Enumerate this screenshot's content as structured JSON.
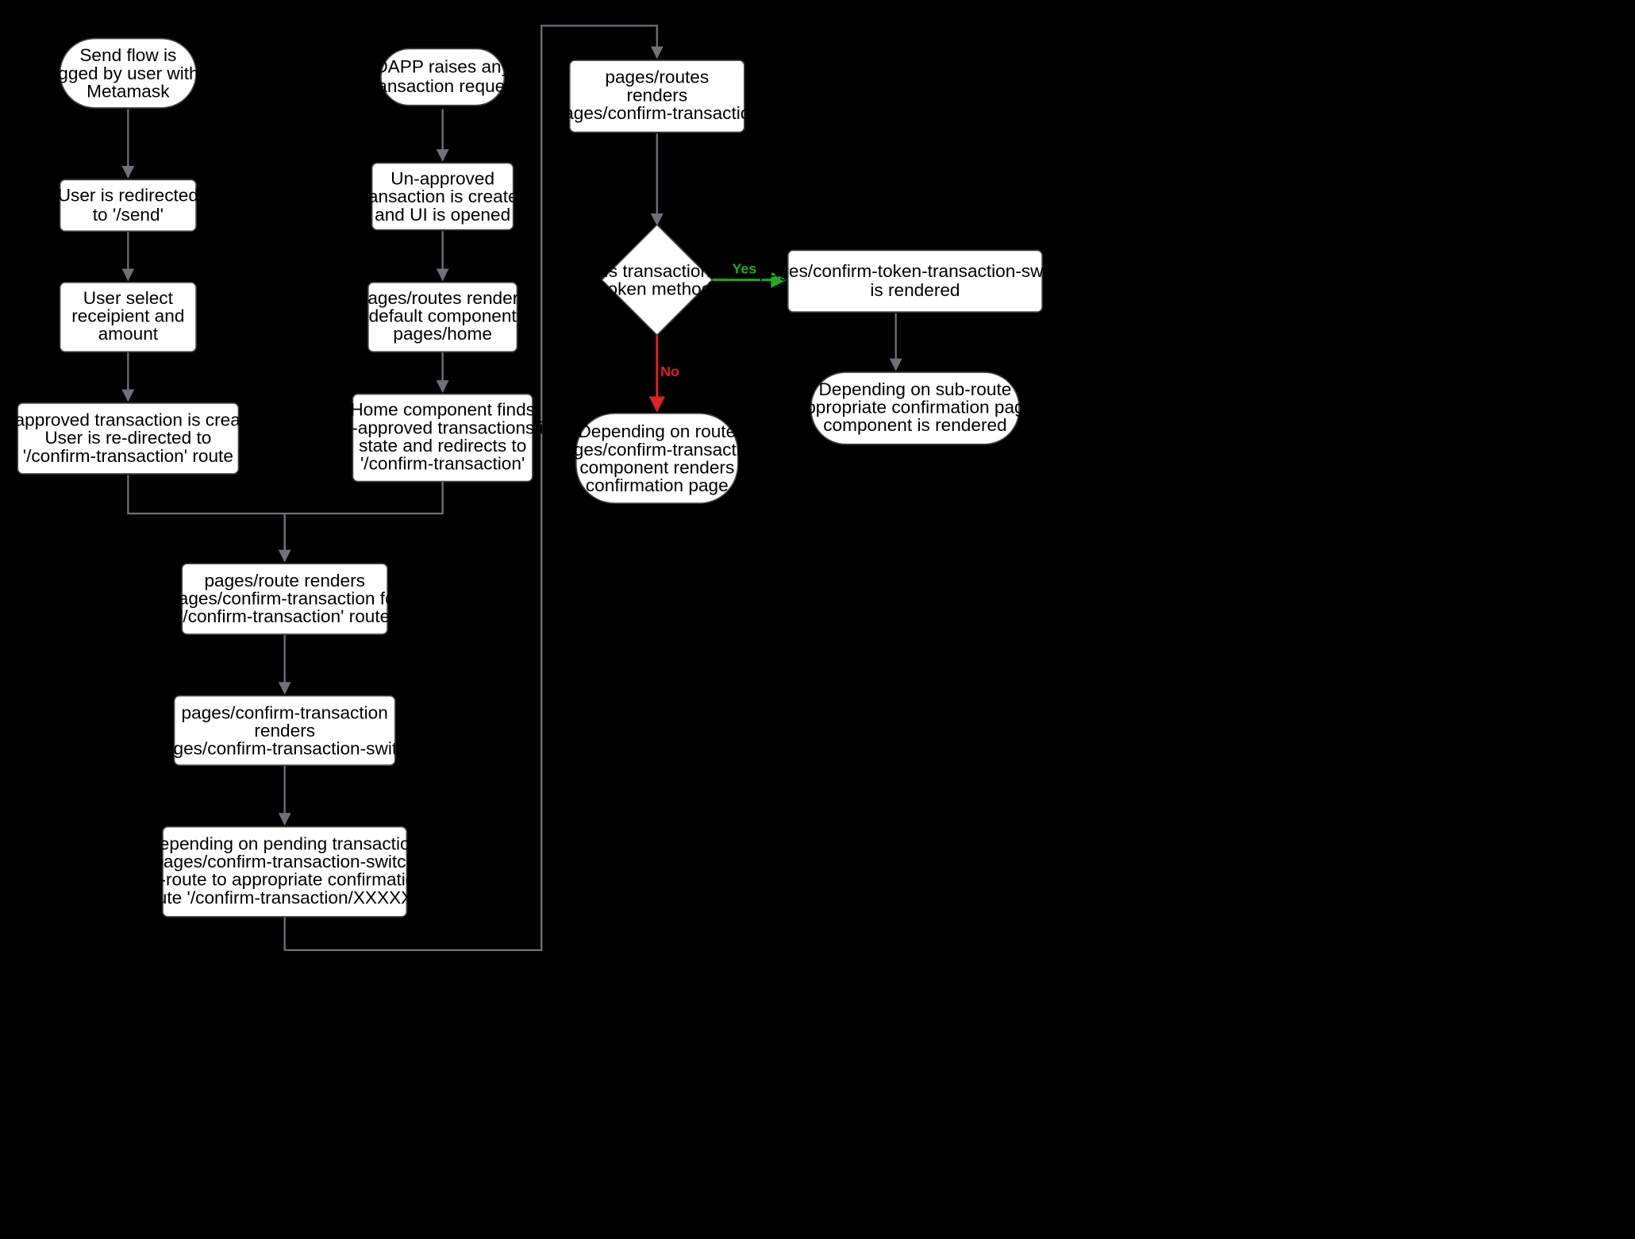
{
  "nodes": {
    "n1": {
      "type": "stadium",
      "lines": [
        "Send flow is",
        "trigged by user within",
        "Metamask"
      ]
    },
    "n2": {
      "type": "rect",
      "lines": [
        "User is redirected",
        "to  '/send'"
      ]
    },
    "n3": {
      "type": "rect",
      "lines": [
        "User select",
        "receipient and",
        "amount"
      ]
    },
    "n4": {
      "type": "rect",
      "lines": [
        "Un-approved transaction is created.",
        "User is re-directed to",
        "'/confirm-transaction' route"
      ]
    },
    "n5": {
      "type": "stadium",
      "lines": [
        "DAPP raises any",
        "transaction request"
      ]
    },
    "n6": {
      "type": "rect",
      "lines": [
        "Un-approved",
        "transaction is created",
        "and UI is opened"
      ]
    },
    "n7": {
      "type": "rect",
      "lines": [
        "pages/routes renders",
        "default component",
        "pages/home"
      ]
    },
    "n8": {
      "type": "rect",
      "lines": [
        "Home component finds",
        "un-approved transactions in",
        "state and redirects to",
        "'/confirm-transaction'"
      ]
    },
    "n9": {
      "type": "rect",
      "lines": [
        "pages/route renders",
        "pages/confirm-transaction for",
        "'/confirm-transaction' route"
      ]
    },
    "n10": {
      "type": "rect",
      "lines": [
        "pages/confirm-transaction",
        "renders",
        "pages/confirm-transaction-switch"
      ]
    },
    "n11": {
      "type": "rect",
      "lines": [
        "depending on pending transaction",
        "pages/confirm-transaction-switch",
        "re-route to appropriate confirmation",
        "route '/confirm-transaction/XXXXXX'"
      ]
    },
    "n12": {
      "type": "rect",
      "lines": [
        "pages/routes",
        "renders",
        "pages/confirm-transaction"
      ]
    },
    "n13": {
      "type": "diamond",
      "lines": [
        "Is transaction",
        "token method"
      ]
    },
    "n14": {
      "type": "rect",
      "lines": [
        "pages/confirm-token-transaction-switch",
        "is rendered"
      ]
    },
    "n15": {
      "type": "stadium",
      "lines": [
        "Depending on route",
        "pages/confirm-transaction",
        "component renders",
        "confirmation page"
      ]
    },
    "n16": {
      "type": "stadium",
      "lines": [
        "Depending on sub-route",
        "appropriate confirmation page",
        "component is rendered"
      ]
    }
  },
  "edges": {
    "yes": "Yes",
    "no": "No"
  },
  "colors": {
    "yes": "#22a822",
    "no": "#d22"
  }
}
